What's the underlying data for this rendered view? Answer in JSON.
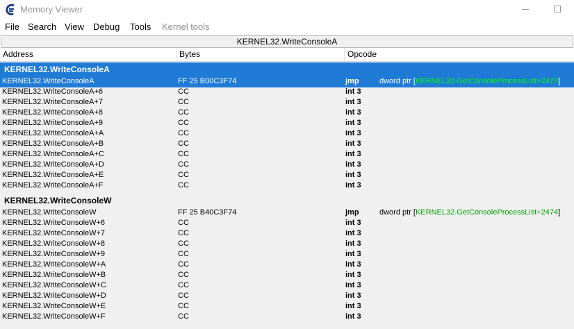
{
  "window": {
    "title": "Memory Viewer"
  },
  "menu": [
    "File",
    "Search",
    "View",
    "Debug",
    "Tools",
    "Kernel tools"
  ],
  "address_bar": "KERNEL32.WriteConsoleA",
  "columns": {
    "address": "Address",
    "bytes": "Bytes",
    "opcode": "Opcode"
  },
  "blocks": [
    {
      "header": "KERNEL32.WriteConsoleA",
      "rows": [
        {
          "address": "KERNEL32.WriteConsoleA",
          "bytes": "FF 25 B00C3F74",
          "op": "jmp",
          "operand_pre": "dword ptr [",
          "operand_sym": "KERNEL32.GetConsoleProcessList+2470",
          "operand_post": "]"
        },
        {
          "address": "KERNEL32.WriteConsoleA+6",
          "bytes": "CC",
          "op": "int 3"
        },
        {
          "address": "KERNEL32.WriteConsoleA+7",
          "bytes": "CC",
          "op": "int 3"
        },
        {
          "address": "KERNEL32.WriteConsoleA+8",
          "bytes": "CC",
          "op": "int 3"
        },
        {
          "address": "KERNEL32.WriteConsoleA+9",
          "bytes": "CC",
          "op": "int 3"
        },
        {
          "address": "KERNEL32.WriteConsoleA+A",
          "bytes": "CC",
          "op": "int 3"
        },
        {
          "address": "KERNEL32.WriteConsoleA+B",
          "bytes": "CC",
          "op": "int 3"
        },
        {
          "address": "KERNEL32.WriteConsoleA+C",
          "bytes": "CC",
          "op": "int 3"
        },
        {
          "address": "KERNEL32.WriteConsoleA+D",
          "bytes": "CC",
          "op": "int 3"
        },
        {
          "address": "KERNEL32.WriteConsoleA+E",
          "bytes": "CC",
          "op": "int 3"
        },
        {
          "address": "KERNEL32.WriteConsoleA+F",
          "bytes": "CC",
          "op": "int 3"
        }
      ]
    },
    {
      "header": "KERNEL32.WriteConsoleW",
      "rows": [
        {
          "address": "KERNEL32.WriteConsoleW",
          "bytes": "FF 25 B40C3F74",
          "op": "jmp",
          "operand_pre": "dword ptr [",
          "operand_sym": "KERNEL32.GetConsoleProcessList+2474",
          "operand_post": "]"
        },
        {
          "address": "KERNEL32.WriteConsoleW+6",
          "bytes": "CC",
          "op": "int 3"
        },
        {
          "address": "KERNEL32.WriteConsoleW+7",
          "bytes": "CC",
          "op": "int 3"
        },
        {
          "address": "KERNEL32.WriteConsoleW+8",
          "bytes": "CC",
          "op": "int 3"
        },
        {
          "address": "KERNEL32.WriteConsoleW+9",
          "bytes": "CC",
          "op": "int 3"
        },
        {
          "address": "KERNEL32.WriteConsoleW+A",
          "bytes": "CC",
          "op": "int 3"
        },
        {
          "address": "KERNEL32.WriteConsoleW+B",
          "bytes": "CC",
          "op": "int 3"
        },
        {
          "address": "KERNEL32.WriteConsoleW+C",
          "bytes": "CC",
          "op": "int 3"
        },
        {
          "address": "KERNEL32.WriteConsoleW+D",
          "bytes": "CC",
          "op": "int 3"
        },
        {
          "address": "KERNEL32.WriteConsoleW+E",
          "bytes": "CC",
          "op": "int 3"
        },
        {
          "address": "KERNEL32.WriteConsoleW+F",
          "bytes": "CC",
          "op": "int 3"
        }
      ]
    }
  ],
  "colors": {
    "selection": "#1f7bd6",
    "symbol": "#00a000",
    "symbol_selected": "#00ff00"
  }
}
